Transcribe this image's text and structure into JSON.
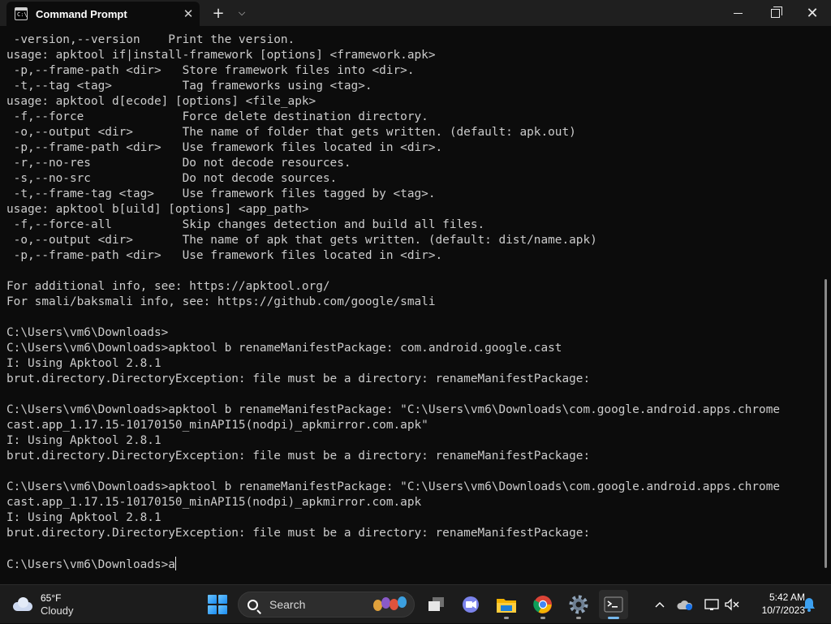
{
  "window": {
    "tab_title": "Command Prompt",
    "tab_icon": "C:\\",
    "new_tab": "+",
    "dropdown": "⌵",
    "close": "✕"
  },
  "terminal": {
    "lines": [
      " -version,--version    Print the version.",
      "usage: apktool if|install-framework [options] <framework.apk>",
      " -p,--frame-path <dir>   Store framework files into <dir>.",
      " -t,--tag <tag>          Tag frameworks using <tag>.",
      "usage: apktool d[ecode] [options] <file_apk>",
      " -f,--force              Force delete destination directory.",
      " -o,--output <dir>       The name of folder that gets written. (default: apk.out)",
      " -p,--frame-path <dir>   Use framework files located in <dir>.",
      " -r,--no-res             Do not decode resources.",
      " -s,--no-src             Do not decode sources.",
      " -t,--frame-tag <tag>    Use framework files tagged by <tag>.",
      "usage: apktool b[uild] [options] <app_path>",
      " -f,--force-all          Skip changes detection and build all files.",
      " -o,--output <dir>       The name of apk that gets written. (default: dist/name.apk)",
      " -p,--frame-path <dir>   Use framework files located in <dir>.",
      "",
      "For additional info, see: https://apktool.org/",
      "For smali/baksmali info, see: https://github.com/google/smali",
      "",
      "C:\\Users\\vm6\\Downloads>",
      "C:\\Users\\vm6\\Downloads>apktool b renameManifestPackage: com.android.google.cast",
      "I: Using Apktool 2.8.1",
      "brut.directory.DirectoryException: file must be a directory: renameManifestPackage:",
      "",
      "C:\\Users\\vm6\\Downloads>apktool b renameManifestPackage: \"C:\\Users\\vm6\\Downloads\\com.google.android.apps.chrome",
      "cast.app_1.17.15-10170150_minAPI15(nodpi)_apkmirror.com.apk\"",
      "I: Using Apktool 2.8.1",
      "brut.directory.DirectoryException: file must be a directory: renameManifestPackage:",
      "",
      "C:\\Users\\vm6\\Downloads>apktool b renameManifestPackage: \"C:\\Users\\vm6\\Downloads\\com.google.android.apps.chrome",
      "cast.app_1.17.15-10170150_minAPI15(nodpi)_apkmirror.com.apk",
      "I: Using Apktool 2.8.1",
      "brut.directory.DirectoryException: file must be a directory: renameManifestPackage:",
      ""
    ],
    "prompt": "C:\\Users\\vm6\\Downloads>",
    "input": "a"
  },
  "taskbar": {
    "weather_temp": "65°F",
    "weather_desc": "Cloudy",
    "search_label": "Search",
    "time": "5:42 AM",
    "date": "10/7/2023"
  },
  "colors": {
    "terminal_bg": "#0c0c0c",
    "terminal_fg": "#cccccc",
    "titlebar_bg": "#1f1f1f",
    "taskbar_bg": "#1c1c1c",
    "accent": "#76b9ed"
  }
}
